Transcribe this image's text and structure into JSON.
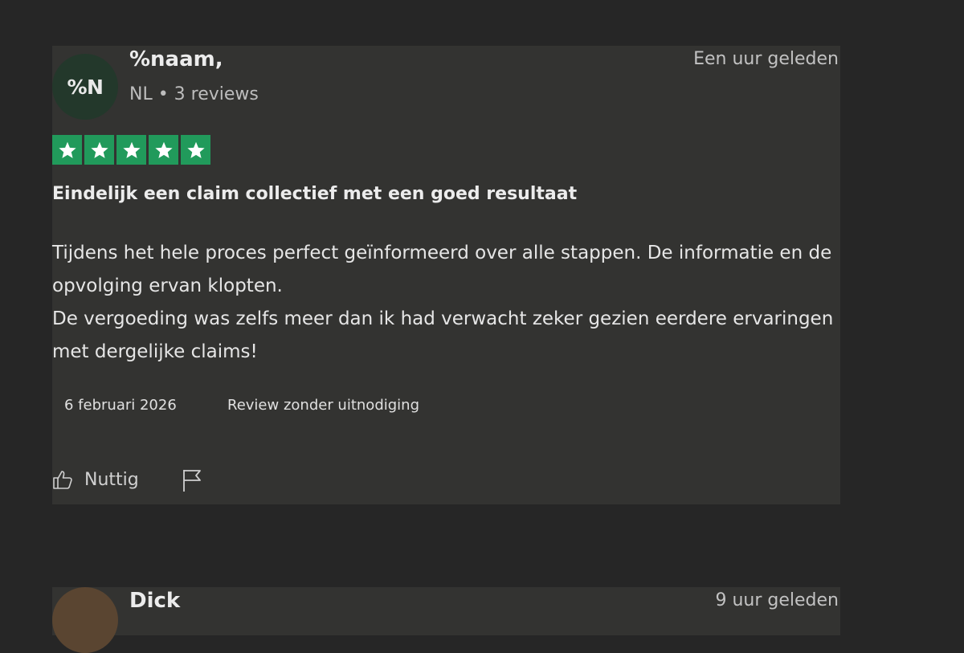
{
  "reviews": [
    {
      "avatar_initials": "%N",
      "name": "%naam,",
      "meta": "NL • 3 reviews",
      "time": "Een uur geleden",
      "rating": 5,
      "title": "Eindelijk een claim collectief met een goed resultaat",
      "body_line1": "Tijdens het hele proces perfect geïnformeerd over alle stappen. De informatie en de opvolging ervan klopten.",
      "body_line2": "De vergoeding was zelfs meer dan ik had verwacht zeker gezien eerdere ervaringen met dergelijke claims!",
      "date": "6 februari 2026",
      "review_label": "Review zonder uitnodiging",
      "useful_label": "Nuttig"
    },
    {
      "name": "Dick",
      "time": "9 uur geleden"
    }
  ],
  "colors": {
    "page_bg": "#262626",
    "card_bg": "#333331",
    "star_green": "#219a5b",
    "avatar_green": "#23382b",
    "avatar_brown": "#5a4531"
  },
  "icons": [
    "star-icon",
    "thumbs-up-icon",
    "flag-icon"
  ]
}
